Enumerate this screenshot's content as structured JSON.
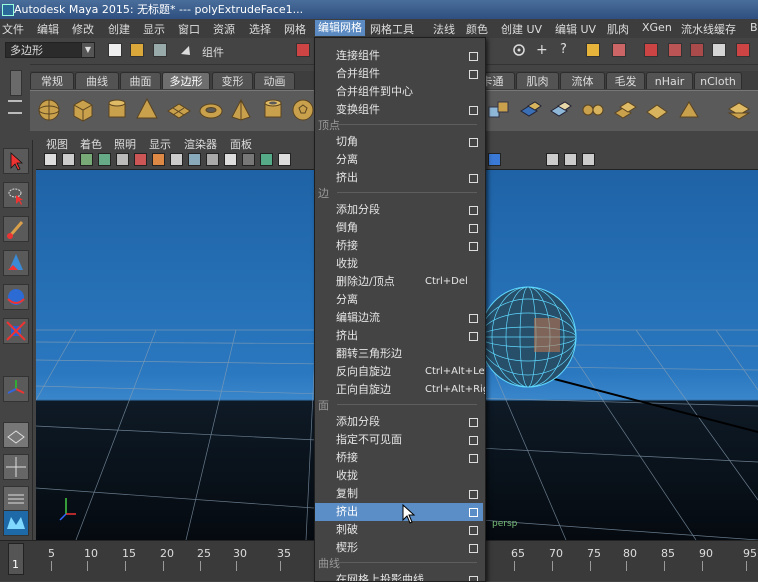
{
  "title": {
    "text": "Autodesk Maya 2015: 无标题*   ---   polyExtrudeFace1..."
  },
  "menubar": {
    "items": [
      {
        "label": "文件"
      },
      {
        "label": "编辑"
      },
      {
        "label": "修改"
      },
      {
        "label": "创建"
      },
      {
        "label": "显示"
      },
      {
        "label": "窗口"
      },
      {
        "label": "资源"
      },
      {
        "label": "选择"
      },
      {
        "label": "网格"
      },
      {
        "label": "编辑网格"
      },
      {
        "label": "网格工具"
      },
      {
        "label": "法线"
      },
      {
        "label": "颜色"
      },
      {
        "label": "创建 UV"
      },
      {
        "label": "编辑 UV"
      },
      {
        "label": "肌肉"
      },
      {
        "label": "XGen"
      },
      {
        "label": "流水线缓存"
      },
      {
        "label": "Bi"
      }
    ],
    "active": "编辑网格"
  },
  "statusline": {
    "mode_select": "多边形",
    "selection_mode": "组件"
  },
  "shelf": {
    "tabs": [
      {
        "label": "常规"
      },
      {
        "label": "曲线"
      },
      {
        "label": "曲面"
      },
      {
        "label": "多边形"
      },
      {
        "label": "变形"
      },
      {
        "label": "动画"
      },
      {
        "label": "卡通"
      },
      {
        "label": "肌肉"
      },
      {
        "label": "流体"
      },
      {
        "label": "毛发"
      },
      {
        "label": "nHair"
      },
      {
        "label": "nCloth"
      }
    ],
    "active_tab": "多边形"
  },
  "panel_menu": {
    "items": [
      {
        "label": "视图"
      },
      {
        "label": "着色"
      },
      {
        "label": "照明"
      },
      {
        "label": "显示"
      },
      {
        "label": "渲染器"
      },
      {
        "label": "面板"
      }
    ]
  },
  "viewport": {
    "camera_label": "persp"
  },
  "timeline": {
    "start_frame": "1",
    "ticks": [
      "5",
      "10",
      "15",
      "20",
      "25",
      "30",
      "35",
      "65",
      "70",
      "75",
      "80",
      "85",
      "90",
      "95"
    ]
  },
  "dropdown": {
    "entries": [
      {
        "kind": "item",
        "label": "连接组件",
        "option": true
      },
      {
        "kind": "item",
        "label": "合并组件",
        "option": true
      },
      {
        "kind": "item",
        "label": "合并组件到中心",
        "option": false
      },
      {
        "kind": "item",
        "label": "变换组件",
        "option": true
      },
      {
        "kind": "section",
        "label": "顶点"
      },
      {
        "kind": "item",
        "label": "切角",
        "option": true
      },
      {
        "kind": "item",
        "label": "分离",
        "option": false
      },
      {
        "kind": "item",
        "label": "挤出",
        "option": true
      },
      {
        "kind": "section",
        "label": "边"
      },
      {
        "kind": "item",
        "label": "添加分段",
        "option": true
      },
      {
        "kind": "item",
        "label": "倒角",
        "option": true
      },
      {
        "kind": "item",
        "label": "桥接",
        "option": true
      },
      {
        "kind": "item",
        "label": "收拢",
        "option": false
      },
      {
        "kind": "item",
        "label": "删除边/顶点",
        "shortcut": "Ctrl+Del",
        "option": false
      },
      {
        "kind": "item",
        "label": "分离",
        "option": false
      },
      {
        "kind": "item",
        "label": "编辑边流",
        "option": true
      },
      {
        "kind": "item",
        "label": "挤出",
        "option": true
      },
      {
        "kind": "item",
        "label": "翻转三角形边",
        "option": false
      },
      {
        "kind": "item",
        "label": "反向自旋边",
        "shortcut": "Ctrl+Alt+Left",
        "option": false
      },
      {
        "kind": "item",
        "label": "正向自旋边",
        "shortcut": "Ctrl+Alt+Right",
        "option": false
      },
      {
        "kind": "section",
        "label": "面"
      },
      {
        "kind": "item",
        "label": "添加分段",
        "option": true
      },
      {
        "kind": "item",
        "label": "指定不可见面",
        "option": true
      },
      {
        "kind": "item",
        "label": "桥接",
        "option": true
      },
      {
        "kind": "item",
        "label": "收拢",
        "option": false
      },
      {
        "kind": "item",
        "label": "复制",
        "option": true
      },
      {
        "kind": "item",
        "label": "挤出",
        "option": true,
        "highlighted": true
      },
      {
        "kind": "item",
        "label": "刺破",
        "option": true
      },
      {
        "kind": "item",
        "label": "楔形",
        "option": true
      },
      {
        "kind": "section",
        "label": "曲线"
      },
      {
        "kind": "item",
        "label": "在网格上投影曲线",
        "option": true
      }
    ]
  },
  "colors": {
    "menu_highlight": "#5b8ec6",
    "viewport_sky": "#2a78c0",
    "wireframe": "#5fd8ff"
  }
}
